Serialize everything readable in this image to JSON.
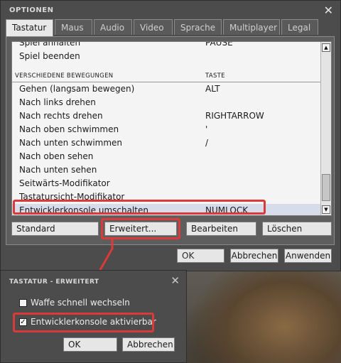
{
  "window": {
    "title": "OPTIONEN",
    "close_icon": "close-icon"
  },
  "tabs": [
    "Tastatur",
    "Maus",
    "Audio",
    "Video",
    "Sprache",
    "Multiplayer",
    "Legal"
  ],
  "active_tab": "Tastatur",
  "list": {
    "top_rows": [
      {
        "action": "Spiel anhalten",
        "key": "PAUSE"
      },
      {
        "action": "Spiel beenden",
        "key": ""
      }
    ],
    "section_header": {
      "action": "VERSCHIEDENE BEWEGUNGEN",
      "key": "TASTE"
    },
    "rows": [
      {
        "action": "Gehen (langsam bewegen)",
        "key": "ALT"
      },
      {
        "action": "Nach links drehen",
        "key": ""
      },
      {
        "action": "Nach rechts drehen",
        "key": "RIGHTARROW"
      },
      {
        "action": "Nach oben schwimmen",
        "key": "'"
      },
      {
        "action": "Nach unten schwimmen",
        "key": "/"
      },
      {
        "action": "Nach oben sehen",
        "key": ""
      },
      {
        "action": "Nach unten sehen",
        "key": ""
      },
      {
        "action": "Seitwärts-Modifikator",
        "key": ""
      },
      {
        "action": "Tastatursicht-Modifikator",
        "key": ""
      },
      {
        "action": "Entwicklerkonsole umschalten",
        "key": "NUMLOCK"
      }
    ]
  },
  "buttons": {
    "standard": "Standard",
    "erweitert": "Erweitert...",
    "bearbeiten": "Bearbeiten",
    "loeschen": "Löschen",
    "ok": "OK",
    "abbrechen": "Abbrechen",
    "anwenden": "Anwenden"
  },
  "dialog": {
    "title": "TASTATUR - ERWEITERT",
    "options": [
      {
        "label": "Waffe schnell wechseln",
        "checked": false
      },
      {
        "label": "Entwicklerkonsole aktivierbar",
        "checked": true
      }
    ],
    "ok": "OK",
    "abbrechen": "Abbrechen"
  },
  "colors": {
    "highlight": "#d93a3a",
    "panel": "#4c4c4c",
    "list_bg": "#f4f4f4",
    "selected_row": "#d7dcea"
  }
}
